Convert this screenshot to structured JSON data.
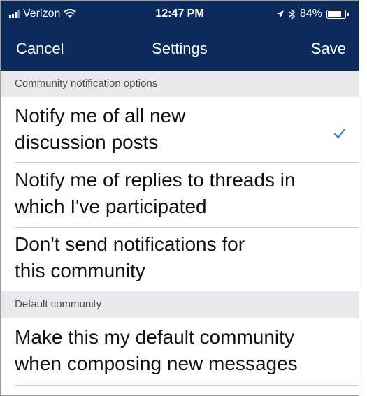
{
  "status_bar": {
    "carrier": "Verizon",
    "time": "12:47 PM",
    "battery": "84%",
    "battery_level": 0.84,
    "icons": [
      "signal-icon",
      "wifi-icon",
      "location-icon",
      "bluetooth-icon",
      "battery-icon"
    ]
  },
  "nav": {
    "cancel_label": "Cancel",
    "title": "Settings",
    "save_label": "Save"
  },
  "sections": [
    {
      "header": "Community notification options",
      "options": [
        {
          "label_line1": "Notify me of all new",
          "label_line2": "discussion posts",
          "selected": true
        },
        {
          "label_line1": "Notify me of replies to threads in",
          "label_line2": "which I've participated",
          "selected": false
        },
        {
          "label_line1": "Don't send notifications for",
          "label_line2": "this community",
          "selected": false
        }
      ]
    },
    {
      "header": "Default community",
      "options": [
        {
          "label_line1": "Make this my default community",
          "label_line2": "when composing new messages",
          "selected": false
        }
      ]
    }
  ],
  "colors": {
    "nav_background": "#0d2a5c",
    "section_background": "#e9e9ec",
    "checkmark": "#2f7fd6"
  }
}
